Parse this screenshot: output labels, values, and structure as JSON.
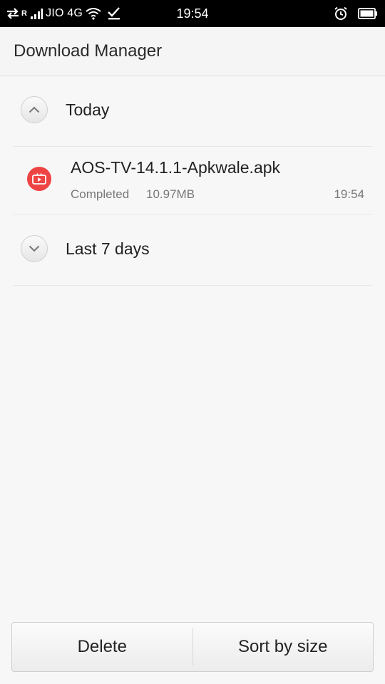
{
  "status_bar": {
    "carrier": "JIO 4G",
    "roaming": "R",
    "time": "19:54"
  },
  "header": {
    "title": "Download Manager"
  },
  "sections": {
    "today": {
      "label": "Today"
    },
    "last7": {
      "label": "Last 7 days"
    }
  },
  "files": [
    {
      "name": "AOS-TV-14.1.1-Apkwale.apk",
      "status": "Completed",
      "size": "10.97MB",
      "time": "19:54",
      "icon": "video-play-icon"
    }
  ],
  "actions": {
    "delete_label": "Delete",
    "sort_label": "Sort by size"
  },
  "colors": {
    "status_bar_bg": "#000000",
    "header_bg": "#f5f5f5",
    "app_icon": "#ef4444"
  }
}
